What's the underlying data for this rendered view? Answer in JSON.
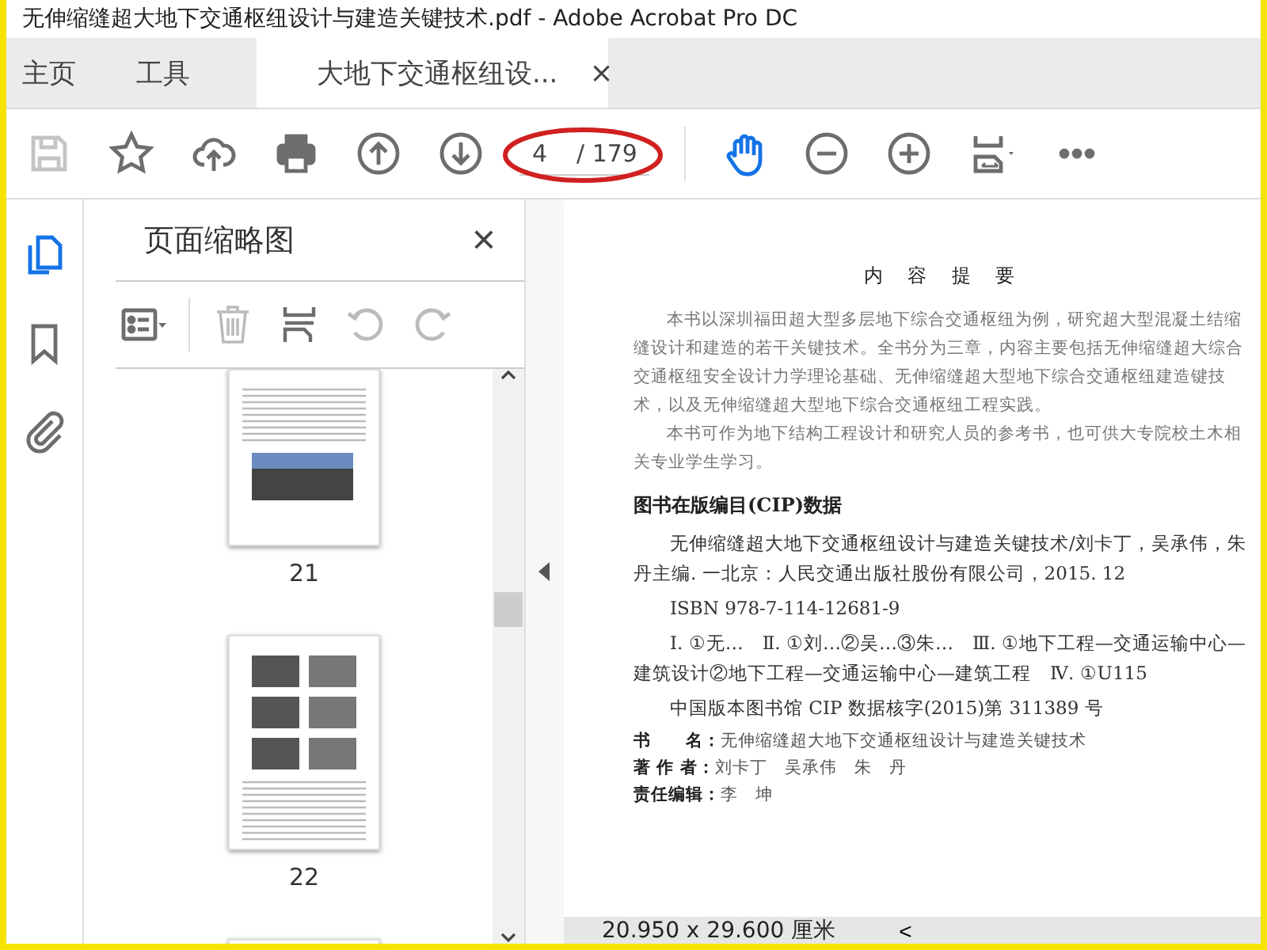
{
  "window": {
    "title": "无伸缩缝超大地下交通枢纽设计与建造关键技术.pdf - Adobe Acrobat Pro DC"
  },
  "tabs": [
    {
      "label": "主页",
      "selected": false,
      "kind": "nav"
    },
    {
      "label": "工具",
      "selected": false,
      "kind": "nav"
    },
    {
      "label": "大地下交通枢纽设...",
      "selected": true,
      "kind": "doc",
      "close": "×"
    }
  ],
  "toolbar": {
    "page_value": "4",
    "page_total": "/ 179",
    "save_disabled": true
  },
  "side_rail": [
    {
      "kind": "pages",
      "selected": true
    },
    {
      "kind": "bookmarks",
      "selected": false
    },
    {
      "kind": "attachments",
      "selected": false
    }
  ],
  "thumbnail_panel": {
    "title": "页面缩略图",
    "close": "×",
    "thumbnails": [
      {
        "label": "21",
        "kind": "photo"
      },
      {
        "label": "22",
        "kind": "grid"
      },
      {
        "kind": "partial"
      }
    ]
  },
  "document": {
    "lines": [
      {
        "kind": "heading",
        "text": "内 容 提 要"
      },
      {
        "kind": "para",
        "text": "本书以深圳福田超大型多层地下综合交通枢纽为例，研究超大型混凝土结缩缝设计和建造的若干关键技术。全书分为三章，内容主要包括无伸缩缝超大综合交通枢纽安全设计力学理论基础、无伸缩缝超大型地下综合交通枢纽建造键技术，以及无伸缩缝超大型地下综合交通枢纽工程实践。"
      },
      {
        "kind": "para",
        "text": "本书可作为地下结构工程设计和研究人员的参考书，也可供大专院校土木相关专业学生学习。"
      },
      {
        "kind": "section",
        "text": "图书在版编目(CIP)数据"
      },
      {
        "kind": "cip",
        "text": "无伸缩缝超大地下交通枢纽设计与建造关键技术/刘卡丁，吴承伟，朱丹主编. 一北京：人民交通出版社股份有限公司，2015. 12"
      },
      {
        "kind": "cip",
        "text": "ISBN 978-7-114-12681-9"
      },
      {
        "kind": "cip",
        "text": "Ⅰ. ①无…　Ⅱ. ①刘…②吴…③朱…　Ⅲ. ①地下工程—交通运输中心—建筑设计②地下工程—交通运输中心—建筑工程　Ⅳ. ①U115"
      },
      {
        "kind": "cip",
        "text": "中国版本图书馆 CIP 数据核字(2015)第 311389 号"
      },
      {
        "kind": "field",
        "label": "书　　名：",
        "text": "无伸缩缝超大地下交通枢纽设计与建造关键技术"
      },
      {
        "kind": "field",
        "label": "著 作 者：",
        "text": "刘卡丁　吴承伟　朱　丹"
      },
      {
        "kind": "field",
        "label": "责任编辑：",
        "text": "李　坤"
      }
    ]
  },
  "status_bar": {
    "page_size": "20.950 x 29.600 厘米",
    "arrow": "<"
  }
}
